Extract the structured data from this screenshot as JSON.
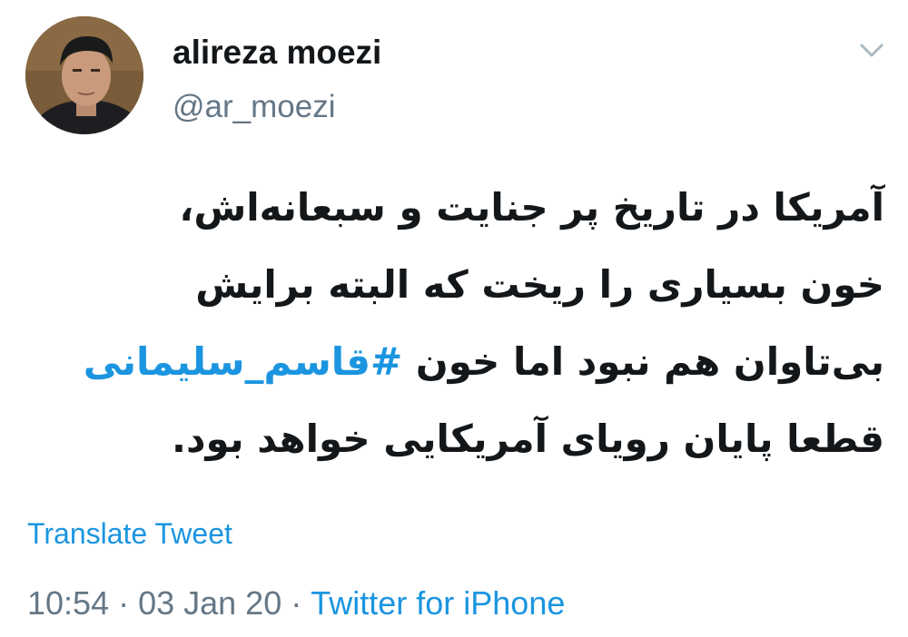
{
  "author": {
    "display_name": "alireza moezi",
    "handle": "@ar_moezi"
  },
  "tweet": {
    "lines": [
      "آمریکا در تاریخ پر جنایت و سبعانه‌اش،",
      "خون بسیاری را ریخت که البته برایش",
      "بی‌تاوان هم نبود اما خون",
      "قطعا پایان رویای آمریکایی خواهد بود."
    ],
    "hashtag": "#قاسم_سلیمانی"
  },
  "translate_label": "Translate Tweet",
  "meta": {
    "time": "10:54",
    "date": "03 Jan 20",
    "separator": "·",
    "source": "Twitter for iPhone"
  },
  "icons": {
    "caret": "chevron-down-icon",
    "avatar": "profile-photo"
  },
  "colors": {
    "link": "#1b95e0",
    "secondary": "#657786",
    "primary_text": "#14171a"
  }
}
